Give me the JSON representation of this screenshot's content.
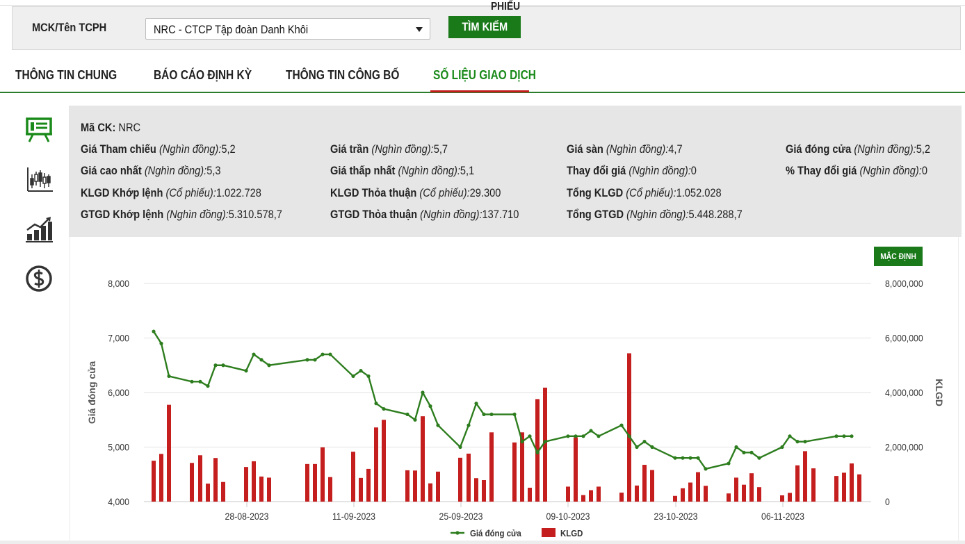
{
  "search": {
    "label": "MCK/Tên TCPH",
    "selected": "NRC - CTCP Tập đoàn Danh Khôi",
    "phieu_text": "PHIẾU",
    "button": "TÌM KIẾM"
  },
  "tabs": [
    {
      "label": "THÔNG TIN CHUNG",
      "active": false
    },
    {
      "label": "BÁO CÁO ĐỊNH KỲ",
      "active": false
    },
    {
      "label": "THÔNG TIN CÔNG BỐ",
      "active": false
    },
    {
      "label": "SỐ LIỆU GIAO DỊCH",
      "active": true
    }
  ],
  "side_icons": [
    "presentation-board-icon",
    "candlestick-chart-icon",
    "growth-bar-chart-icon",
    "dollar-coin-icon"
  ],
  "info": {
    "ma_ck_label": "Mã CK:",
    "ma_ck_value": "NRC",
    "rows": [
      [
        {
          "label": "Giá Tham chiếu",
          "unit": "(Nghìn đồng):",
          "value": "5,2"
        },
        {
          "label": "Giá trần",
          "unit": "(Nghìn đồng):",
          "value": "5,7"
        },
        {
          "label": "Giá sàn",
          "unit": "(Nghìn đồng):",
          "value": "4,7"
        },
        {
          "label": "Giá đóng cửa",
          "unit": "(Nghìn đồng):",
          "value": "5,2"
        }
      ],
      [
        {
          "label": "Giá cao nhất",
          "unit": "(Nghìn đồng):",
          "value": "5,3"
        },
        {
          "label": "Giá thấp nhất",
          "unit": "(Nghìn đồng):",
          "value": "5,1"
        },
        {
          "label": "Thay đổi giá",
          "unit": "(Nghìn đồng):",
          "value": "0"
        },
        {
          "label": "% Thay đổi giá",
          "unit": "(Nghìn đồng):",
          "value": "0"
        }
      ],
      [
        {
          "label": "KLGD Khớp lệnh",
          "unit": "(Cổ phiếu):",
          "value": "1.022.728"
        },
        {
          "label": "KLGD Thỏa thuận",
          "unit": "(Cổ phiếu):",
          "value": "29.300"
        },
        {
          "label": "Tổng KLGD",
          "unit": "(Cổ phiếu):",
          "value": "1.052.028"
        }
      ],
      [
        {
          "label": "GTGD Khớp lệnh",
          "unit": "(Nghìn đồng):",
          "value": "5.310.578,7"
        },
        {
          "label": "GTGD Thỏa thuận",
          "unit": "(Nghìn đồng):",
          "value": "137.710"
        },
        {
          "label": "Tổng GTGD",
          "unit": "(Nghìn đồng):",
          "value": "5.448.288,7"
        }
      ]
    ]
  },
  "chart_controls": {
    "reset_label": "MẶC ĐỊNH"
  },
  "colors": {
    "brand_green": "#1a7a1a",
    "price_line": "#2d7d1e",
    "volume_bar": "#c41e1e",
    "tab_underline": "#c41d1d"
  },
  "chart_data": {
    "type": "bar+line",
    "xlabel": "",
    "ylabel_left": "Giá đóng cửa",
    "ylabel_right": "KLGD",
    "ylim_left": [
      4000,
      8000
    ],
    "ylim_right": [
      0,
      8000000
    ],
    "yticks_left": [
      "4,000",
      "5,000",
      "6,000",
      "7,000",
      "8,000"
    ],
    "yticks_right": [
      "0",
      "2,000,000",
      "4,000,000",
      "6,000,000",
      "8,000,000"
    ],
    "xticks": [
      "28-08-2023",
      "11-09-2023",
      "25-09-2023",
      "09-10-2023",
      "23-10-2023",
      "06-11-2023"
    ],
    "grid": true,
    "legend_position": "bottom-center",
    "series": [
      {
        "name": "Giá đóng cửa",
        "type": "line",
        "values": [
          7120,
          6900,
          6300,
          6200,
          6200,
          6120,
          6500,
          6500,
          6400,
          6700,
          6600,
          6500,
          6600,
          6600,
          6700,
          6700,
          6300,
          6400,
          6300,
          5800,
          5700,
          5600,
          5500,
          6000,
          5750,
          5400,
          5000,
          5400,
          5800,
          5600,
          5600,
          5600,
          5100,
          5200,
          4900,
          5100,
          5200,
          5200,
          5200,
          5300,
          5200,
          5400,
          5200,
          5000,
          5100,
          5000,
          4800,
          4800,
          4800,
          4800,
          4600,
          4700,
          5000,
          4900,
          4900,
          4800,
          5000,
          5200,
          5100,
          5100,
          5200,
          5200,
          5200
        ]
      },
      {
        "name": "KLGD",
        "type": "bar",
        "values": [
          1500000,
          1750000,
          3550000,
          1420000,
          1700000,
          660000,
          1600000,
          720000,
          1270000,
          1480000,
          920000,
          880000,
          1380000,
          1380000,
          1990000,
          900000,
          1830000,
          870000,
          1200000,
          2720000,
          3000000,
          1150000,
          1140000,
          3130000,
          670000,
          1100000,
          1610000,
          1760000,
          860000,
          790000,
          2540000,
          2170000,
          2540000,
          510000,
          3760000,
          4180000,
          550000,
          2360000,
          240000,
          420000,
          550000,
          330000,
          5440000,
          590000,
          1350000,
          1160000,
          210000,
          490000,
          700000,
          1080000,
          580000,
          300000,
          880000,
          620000,
          1040000,
          530000,
          230000,
          320000,
          1330000,
          1850000,
          1220000,
          940000,
          1060000,
          1400000,
          1000000
        ]
      }
    ]
  }
}
